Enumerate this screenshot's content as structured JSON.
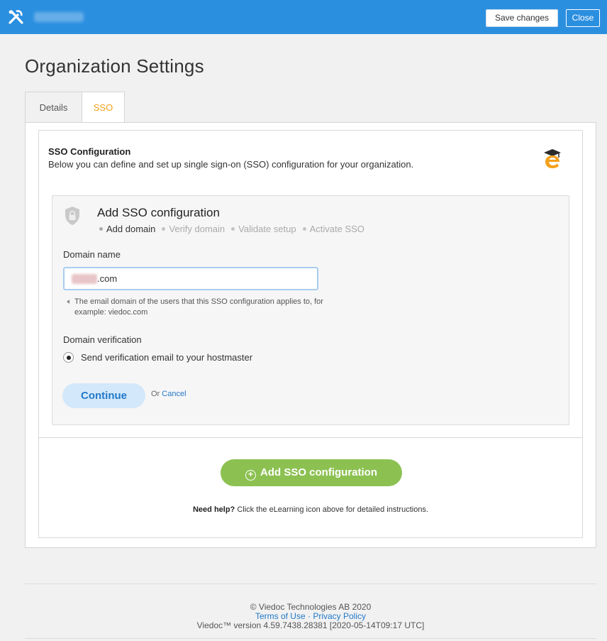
{
  "topbar": {
    "logo_icon": "tools-icon",
    "save_label": "Save changes",
    "close_label": "Close",
    "color": "#2b8fe0"
  },
  "page": {
    "title": "Organization Settings"
  },
  "tabs": [
    {
      "label": "Details",
      "active": false
    },
    {
      "label": "SSO",
      "active": true
    }
  ],
  "sso": {
    "title": "SSO Configuration",
    "description": "Below you can define and set up single sign-on (SSO) configuration for your organization.",
    "elearning_icon": "elearning-icon",
    "add_config": {
      "title": "Add SSO configuration",
      "steps": [
        {
          "label": "Add domain",
          "active": true
        },
        {
          "label": "Verify domain",
          "active": false
        },
        {
          "label": "Validate setup",
          "active": false
        },
        {
          "label": "Activate SSO",
          "active": false
        }
      ],
      "domain_label": "Domain name",
      "domain_value": ".com",
      "domain_hint": "The email domain of the users that this SSO configuration applies to, for example: viedoc.com",
      "verification_label": "Domain verification",
      "verification_option": "Send verification email to your hostmaster",
      "continue_label": "Continue",
      "or_label": "Or ",
      "cancel_label": "Cancel"
    },
    "add_button_label": "Add SSO configuration",
    "help": {
      "bold": "Need help?",
      "text": " Click the eLearning icon above for detailed instructions."
    }
  },
  "footer": {
    "copyright": "© Viedoc Technologies AB 2020",
    "terms_label": "Terms of Use",
    "separator": " · ",
    "privacy_label": "Privacy Policy",
    "version": "Viedoc™ version 4.59.7438.28381 [2020-05-14T09:17 UTC]"
  },
  "colors": {
    "accent_orange": "#f4a11a",
    "link_blue": "#2279c9",
    "green_button": "#8cc152"
  }
}
